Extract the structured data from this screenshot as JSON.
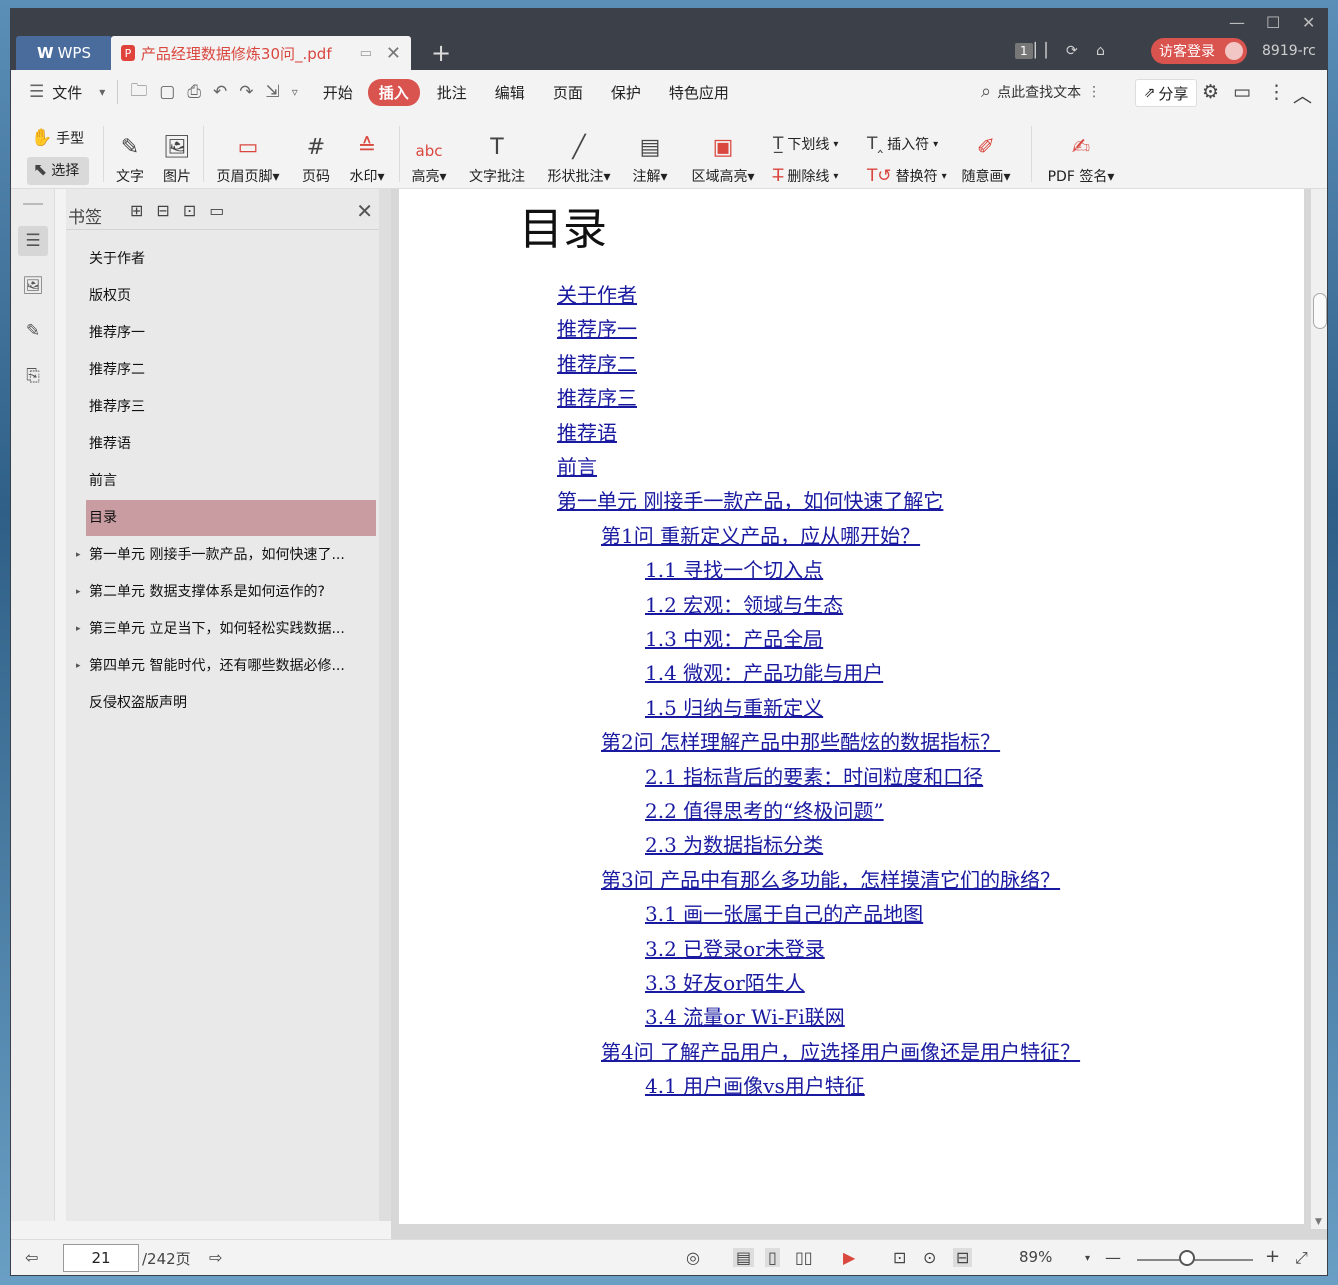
{
  "titlebar": {
    "app_tab": "WPS",
    "doc_tab": "产品经理数据修炼30问_.pdf",
    "page_badge": "1",
    "login": "访客登录",
    "version": "8919-rc"
  },
  "menubar": {
    "items": [
      "文件",
      "开始",
      "插入",
      "批注",
      "编辑",
      "页面",
      "保护",
      "特色应用"
    ],
    "active": "插入",
    "search": "点此查找文本",
    "share": "分享"
  },
  "ribbon": {
    "hand": "手型",
    "select": "选择",
    "text": "文字",
    "image": "图片",
    "header_footer": "页眉页脚",
    "page_num": "页码",
    "watermark": "水印",
    "highlight": "高亮",
    "text_comment": "文字批注",
    "shape_comment": "形状批注",
    "annotate": "注解",
    "area_highlight": "区域高亮",
    "underline": "下划线",
    "strikethrough": "删除线",
    "insert_char": "插入符",
    "replace_char": "替换符",
    "freehand": "随意画",
    "pdf_sign": "PDF 签名"
  },
  "bookmarks": {
    "title": "书签",
    "items": [
      {
        "label": "关于作者",
        "expandable": false
      },
      {
        "label": "版权页",
        "expandable": false
      },
      {
        "label": "推荐序一",
        "expandable": false
      },
      {
        "label": "推荐序二",
        "expandable": false
      },
      {
        "label": "推荐序三",
        "expandable": false
      },
      {
        "label": "推荐语",
        "expandable": false
      },
      {
        "label": "前言",
        "expandable": false
      },
      {
        "label": "目录",
        "expandable": false,
        "selected": true
      },
      {
        "label": "第一单元 刚接手一款产品，如何快速了...",
        "expandable": true
      },
      {
        "label": "第二单元 数据支撑体系是如何运作的?",
        "expandable": true
      },
      {
        "label": "第三单元 立足当下，如何轻松实践数据...",
        "expandable": true
      },
      {
        "label": "第四单元 智能时代，还有哪些数据必修...",
        "expandable": true
      },
      {
        "label": "反侵权盗版声明",
        "expandable": false
      }
    ]
  },
  "document": {
    "heading": "目录",
    "toc": [
      {
        "text": "关于作者",
        "level": 0
      },
      {
        "text": "推荐序一",
        "level": 0
      },
      {
        "text": "推荐序二",
        "level": 0
      },
      {
        "text": "推荐序三",
        "level": 0
      },
      {
        "text": "推荐语",
        "level": 0
      },
      {
        "text": "前言",
        "level": 0
      },
      {
        "text": "第一单元 刚接手一款产品，如何快速了解它",
        "level": 0
      },
      {
        "text": "第1问 重新定义产品，应从哪开始？",
        "level": 1
      },
      {
        "text": "1.1 寻找一个切入点",
        "level": 2
      },
      {
        "text": "1.2 宏观：领域与生态",
        "level": 2
      },
      {
        "text": "1.3 中观：产品全局",
        "level": 2
      },
      {
        "text": "1.4 微观：产品功能与用户",
        "level": 2
      },
      {
        "text": "1.5 归纳与重新定义",
        "level": 2
      },
      {
        "text": "第2问 怎样理解产品中那些酷炫的数据指标？",
        "level": 1
      },
      {
        "text": "2.1 指标背后的要素：时间粒度和口径",
        "level": 2
      },
      {
        "text": "2.2 值得思考的“终极问题”",
        "level": 2
      },
      {
        "text": "2.3 为数据指标分类",
        "level": 2
      },
      {
        "text": "第3问 产品中有那么多功能，怎样摸清它们的脉络？",
        "level": 1
      },
      {
        "text": "3.1 画一张属于自己的产品地图",
        "level": 2
      },
      {
        "text": "3.2 已登录or未登录",
        "level": 2
      },
      {
        "text": "3.3 好友or陌生人",
        "level": 2
      },
      {
        "text": "3.4 流量or Wi-Fi联网",
        "level": 2
      },
      {
        "text": "第4问 了解产品用户，应选择用户画像还是用户特征？",
        "level": 1
      },
      {
        "text": "4.1 用户画像vs用户特征",
        "level": 2
      }
    ]
  },
  "statusbar": {
    "current_page": "21",
    "total_pages": "/242页",
    "zoom": "89%"
  }
}
